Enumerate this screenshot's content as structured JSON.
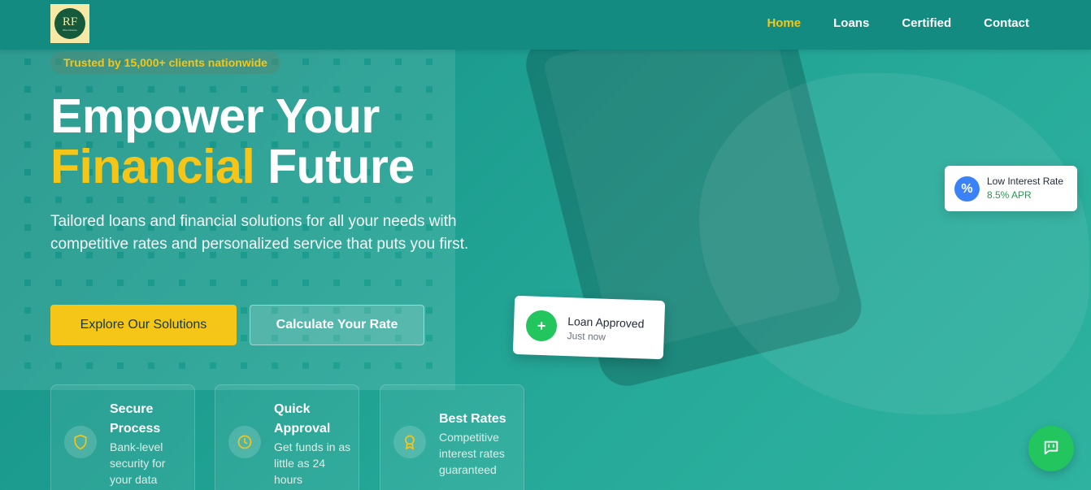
{
  "logo": {
    "letters": "RF",
    "subtext": "Rise Finance"
  },
  "nav": {
    "items": [
      {
        "label": "Home",
        "active": true
      },
      {
        "label": "Loans",
        "active": false
      },
      {
        "label": "Certified",
        "active": false
      },
      {
        "label": "Contact",
        "active": false
      }
    ]
  },
  "hero": {
    "badge": "Trusted by 15,000+ clients nationwide",
    "headline_line1": "Empower Your",
    "headline_highlight": "Financial",
    "headline_rest": "Future",
    "subtitle": "Tailored loans and financial solutions for all your needs with competitive rates and personalized service that puts you first.",
    "primary_button": "Explore Our Solutions",
    "secondary_button": "Calculate Your Rate"
  },
  "features": [
    {
      "title": "Secure Process",
      "description": "Bank-level security for your data",
      "icon": "shield-icon"
    },
    {
      "title": "Quick Approval",
      "description": "Get funds in as little as 24 hours",
      "icon": "clock-icon"
    },
    {
      "title": "Best Rates",
      "description": "Competitive interest rates guaranteed",
      "icon": "award-icon"
    }
  ],
  "rate_card": {
    "icon_glyph": "%",
    "title": "Low Interest Rate",
    "value": "8.5% APR"
  },
  "loan_card": {
    "icon_glyph": "+",
    "title": "Loan Approved",
    "subtitle": "Just now"
  },
  "chat": {
    "icon": "chat-icon"
  },
  "colors": {
    "accent": "#f5c518",
    "brand": "#138b80",
    "success": "#22c55e",
    "info": "#3b82f6"
  }
}
